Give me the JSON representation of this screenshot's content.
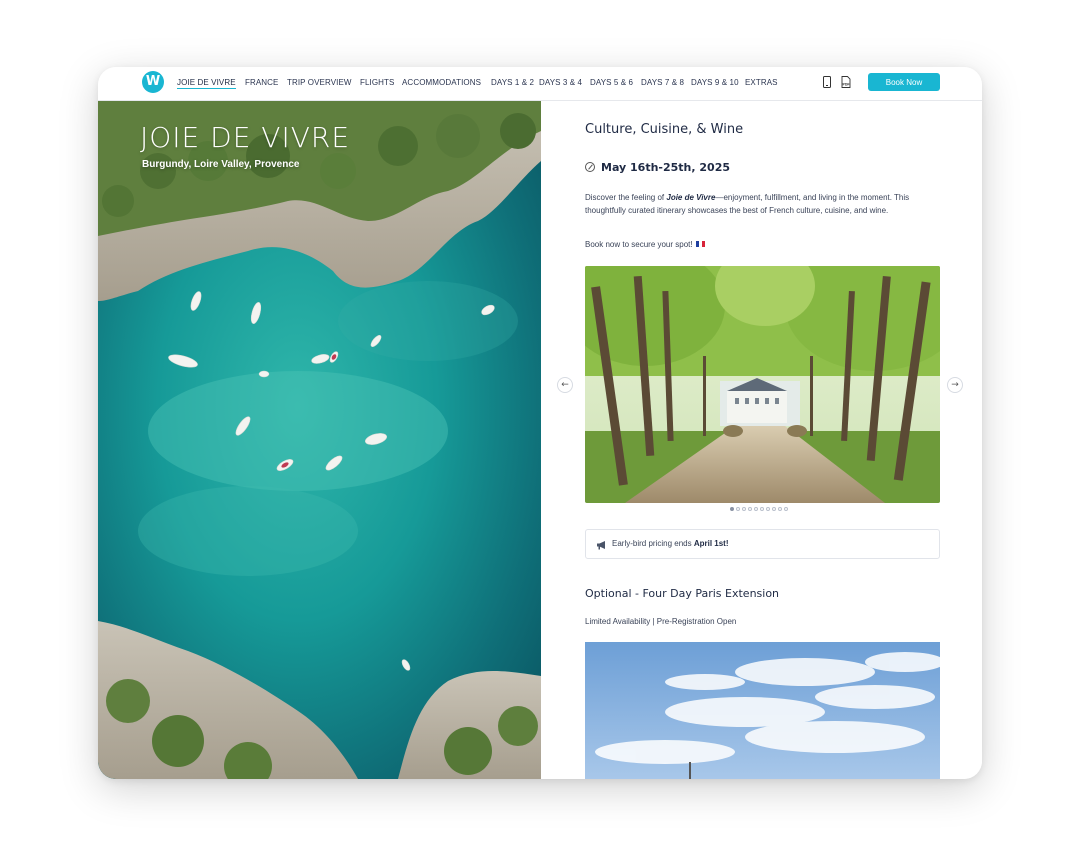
{
  "nav": {
    "logo_text": "W",
    "links": [
      "JOIE DE VIVRE",
      "FRANCE",
      "TRIP OVERVIEW",
      "FLIGHTS",
      "ACCOMMODATIONS",
      "DAYS 1 & 2",
      "DAYS 3 & 4",
      "DAYS 5 & 6",
      "DAYS 7 & 8",
      "DAYS 9 & 10",
      "EXTRAS"
    ],
    "active_link": "JOIE DE VIVRE",
    "mobile_icon": "mobile-phone-icon",
    "pdf_icon": "pdf-icon",
    "pdf_icon_text": "PDF",
    "book_label": "Book Now",
    "accent_color": "#19b6d2"
  },
  "hero": {
    "title": "JOIE DE VIVRE",
    "subtitle": "Burgundy, Loire Valley, Provence"
  },
  "content": {
    "heading": "Culture, Cuisine, & Wine",
    "date": "May 16th-25th, 2025",
    "desc_pre": "Discover the feeling of ",
    "desc_em": "Joie de Vivre",
    "desc_post": "—enjoyment, fulfillment, and living in the moment. This thoughtfully curated itinerary showcases the best of French culture, cuisine, and wine.",
    "book_text": "Book now to secure your spot!",
    "carousel": {
      "prev_icon": "arrow-left-icon",
      "next_icon": "arrow-right-icon",
      "prev_symbol": "←",
      "next_symbol": "→",
      "slide_count": 10,
      "active_slide": 1
    },
    "notice_pre": "Early-bird pricing ends ",
    "notice_bold": "April 1st!",
    "extension_heading": "Optional - Four Day Paris Extension",
    "extension_status": "Limited Availability | Pre-Registration Open"
  }
}
